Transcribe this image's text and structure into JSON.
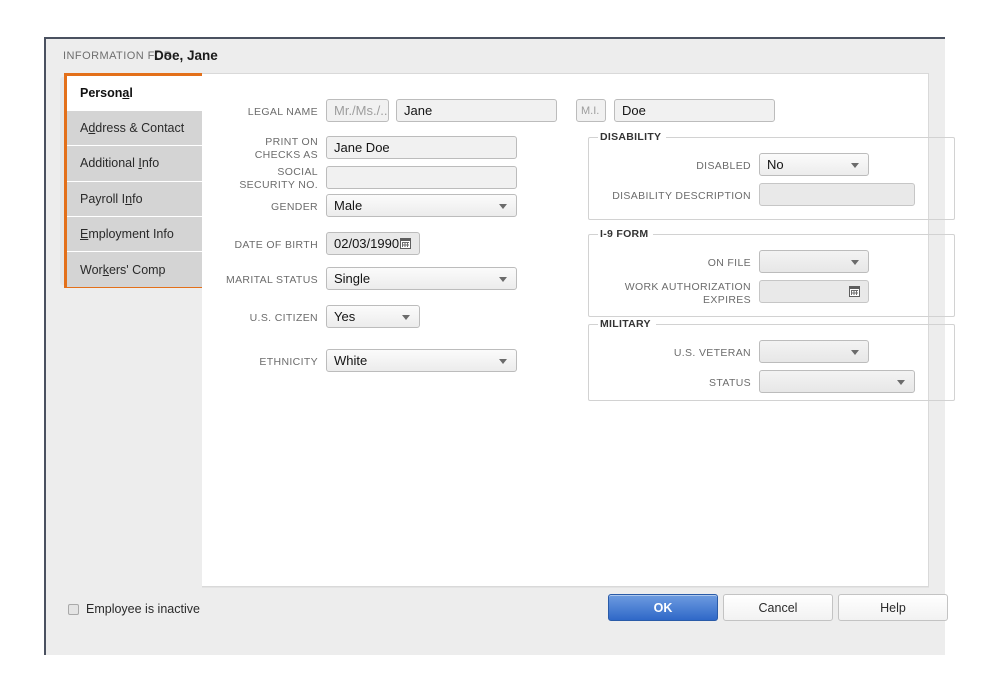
{
  "header": {
    "prefix": "INFORMATION FOR",
    "employee_name": "Doe, Jane"
  },
  "accent_color": "#E3701A",
  "tabs": [
    {
      "name": "personal",
      "label": "Personal",
      "mnemonic": "a",
      "active": true
    },
    {
      "name": "address-contact",
      "label": "Address & Contact",
      "mnemonic": "d",
      "active": false
    },
    {
      "name": "additional-info",
      "label": "Additional Info",
      "mnemonic": "I",
      "active": false
    },
    {
      "name": "payroll-info",
      "label": "Payroll Info",
      "mnemonic": "n",
      "active": false
    },
    {
      "name": "employment-info",
      "label": "Employment Info",
      "mnemonic": "E",
      "active": false
    },
    {
      "name": "workers-comp",
      "label": "Workers' Comp",
      "mnemonic": "k",
      "active": false
    }
  ],
  "form": {
    "legal_name": {
      "label": "LEGAL NAME",
      "title_placeholder": "Mr./Ms./..",
      "title_value": "",
      "first_value": "Jane",
      "mi_placeholder": "M.I.",
      "mi_value": "",
      "last_value": "Doe"
    },
    "print_on_checks_as": {
      "label": "PRINT ON\nCHECKS AS",
      "label_line1": "PRINT ON",
      "label_line2": "CHECKS AS",
      "value": "Jane Doe"
    },
    "social_security_no": {
      "label_line1": "SOCIAL",
      "label_line2": "SECURITY NO.",
      "value": ""
    },
    "gender": {
      "label": "GENDER",
      "value": "Male"
    },
    "date_of_birth": {
      "label": "DATE OF BIRTH",
      "value": "02/03/1990"
    },
    "marital_status": {
      "label": "MARITAL STATUS",
      "value": "Single"
    },
    "us_citizen": {
      "label": "U.S. CITIZEN",
      "value": "Yes"
    },
    "ethnicity": {
      "label": "ETHNICITY",
      "value": "White"
    }
  },
  "disability": {
    "title": "DISABILITY",
    "disabled": {
      "label": "DISABLED",
      "value": "No"
    },
    "description": {
      "label": "DISABILITY DESCRIPTION",
      "value": ""
    }
  },
  "i9_form": {
    "title": "I-9 FORM",
    "on_file": {
      "label": "ON FILE",
      "value": ""
    },
    "work_authorization_expires": {
      "label_line1": "WORK AUTHORIZATION",
      "label_line2": "EXPIRES",
      "value": ""
    }
  },
  "military": {
    "title": "MILITARY",
    "us_veteran": {
      "label": "U.S. VETERAN",
      "value": ""
    },
    "status": {
      "label": "STATUS",
      "value": ""
    }
  },
  "footer": {
    "inactive_checkbox_label": "Employee is inactive",
    "inactive_checked": false,
    "ok_label": "OK",
    "cancel_label": "Cancel",
    "help_label": "Help"
  }
}
